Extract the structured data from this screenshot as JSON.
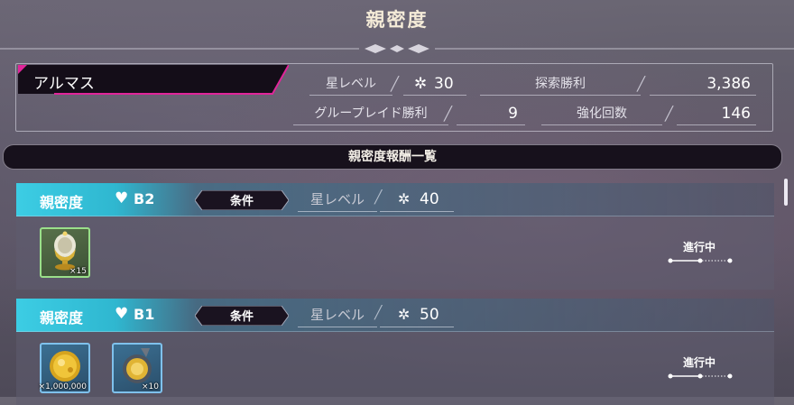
{
  "header": {
    "title": "親密度"
  },
  "character": {
    "name": "アルマス"
  },
  "stats": {
    "star_level_label": "星レベル",
    "star_level_value": "30",
    "explore_wins_label": "探索勝利",
    "explore_wins_value": "3,386",
    "raid_wins_label": "グループレイド勝利",
    "raid_wins_value": "9",
    "enhance_count_label": "強化回数",
    "enhance_count_value": "146"
  },
  "reward_list": {
    "header": "親密度報酬一覧",
    "items": [
      {
        "label": "親密度",
        "rank": "B2",
        "condition_badge": "条件",
        "requirement_label": "星レベル",
        "requirement_value": "40",
        "status": "進行中",
        "rewards": [
          {
            "icon": "golden-chalice-icon",
            "qty": "×15",
            "frame_color": "#9adf8a"
          }
        ]
      },
      {
        "label": "親密度",
        "rank": "B1",
        "condition_badge": "条件",
        "requirement_label": "星レベル",
        "requirement_value": "50",
        "status": "進行中",
        "rewards": [
          {
            "icon": "gold-coin-icon",
            "qty": "×1,000,000",
            "frame_color": "#7fc1ec"
          },
          {
            "icon": "gold-medal-icon",
            "qty": "×10",
            "frame_color": "#7fc1ec"
          }
        ]
      }
    ]
  },
  "colors": {
    "accent_cyan": "#3ccde4",
    "accent_magenta": "#e0259a",
    "badge_dark": "#1a1320"
  }
}
